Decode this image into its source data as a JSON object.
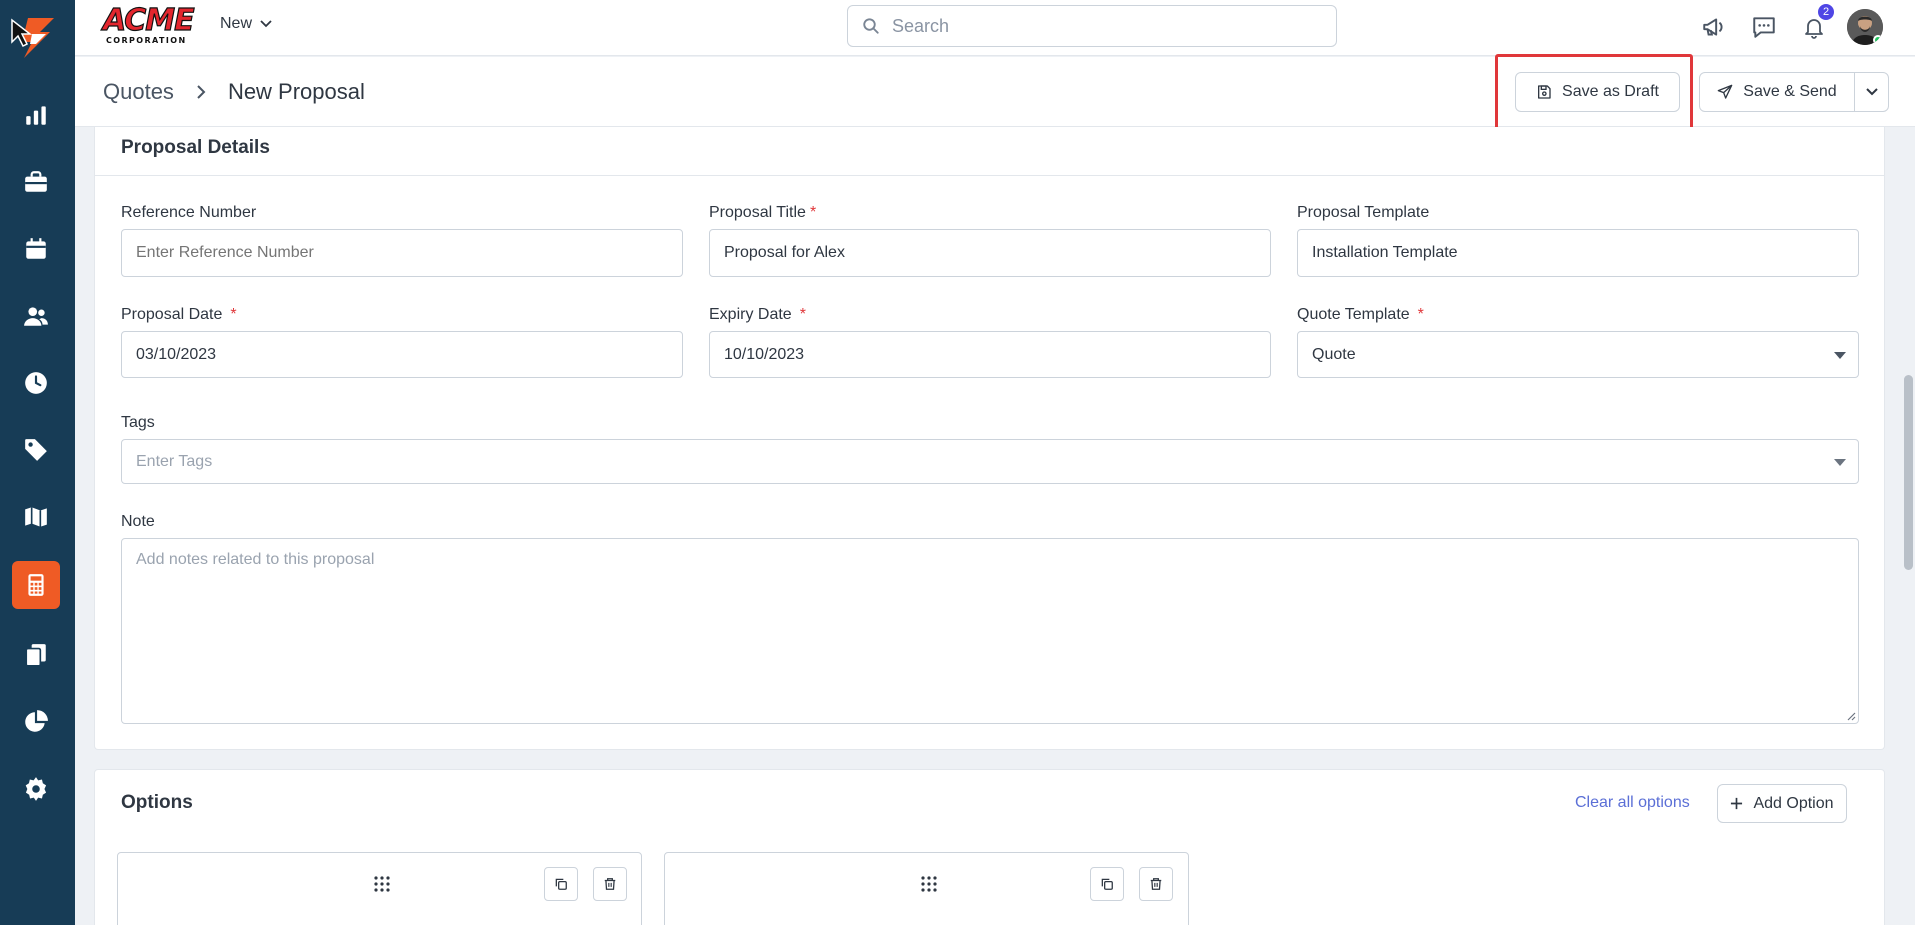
{
  "topbar": {
    "brand_name": "ACME",
    "brand_sub": "CORPORATION",
    "new_label": "New",
    "search_placeholder": "Search",
    "notification_count": "2"
  },
  "header": {
    "breadcrumb_root": "Quotes",
    "breadcrumb_current": "New Proposal",
    "save_draft_label": "Save as Draft",
    "save_send_label": "Save & Send"
  },
  "sidebar": {
    "items": [
      {
        "icon": "bar-chart-icon"
      },
      {
        "icon": "briefcase-icon"
      },
      {
        "icon": "calendar-icon"
      },
      {
        "icon": "users-icon"
      },
      {
        "icon": "clock-icon"
      },
      {
        "icon": "tag-icon"
      },
      {
        "icon": "map-icon"
      },
      {
        "icon": "calculator-icon",
        "active": true
      },
      {
        "icon": "documents-icon"
      },
      {
        "icon": "pie-chart-icon"
      },
      {
        "icon": "gear-icon"
      }
    ],
    "active_color": "#ef5b25",
    "background": "#173c56"
  },
  "details": {
    "title": "Proposal Details",
    "reference_label": "Reference Number",
    "reference_placeholder": "Enter Reference Number",
    "title_label": "Proposal Title",
    "title_value": "Proposal for Alex",
    "template_label": "Proposal Template",
    "template_value": "Installation Template",
    "date_label": "Proposal Date",
    "date_value": "03/10/2023",
    "expiry_label": "Expiry Date",
    "expiry_value": "10/10/2023",
    "quote_template_label": "Quote Template",
    "quote_template_value": "Quote",
    "tags_label": "Tags",
    "tags_placeholder": "Enter Tags",
    "note_label": "Note",
    "note_placeholder": "Add notes related to this proposal",
    "required_mark": "*"
  },
  "options": {
    "title": "Options",
    "clear_label": "Clear all options",
    "add_label": "Add Option"
  }
}
